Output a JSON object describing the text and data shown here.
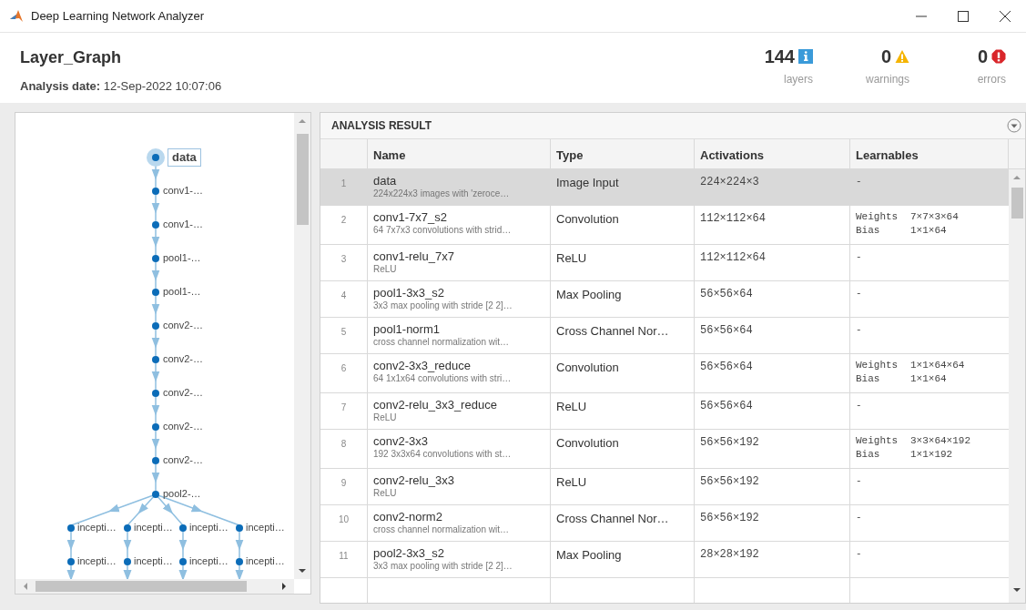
{
  "window": {
    "title": "Deep Learning Network Analyzer"
  },
  "header": {
    "network_name": "Layer_Graph",
    "date_label": "Analysis date:",
    "date_value": "12-Sep-2022 10:07:06"
  },
  "stats": [
    {
      "kind": "info",
      "count": "144",
      "label": "layers"
    },
    {
      "kind": "warning",
      "count": "0",
      "label": "warnings"
    },
    {
      "kind": "error",
      "count": "0",
      "label": "errors"
    }
  ],
  "graph": {
    "chain": [
      {
        "label": "data",
        "selected": true
      },
      {
        "label": "conv1-…",
        "selected": false
      },
      {
        "label": "conv1-…",
        "selected": false
      },
      {
        "label": "pool1-…",
        "selected": false
      },
      {
        "label": "pool1-…",
        "selected": false
      },
      {
        "label": "conv2-…",
        "selected": false
      },
      {
        "label": "conv2-…",
        "selected": false
      },
      {
        "label": "conv2-…",
        "selected": false
      },
      {
        "label": "conv2-…",
        "selected": false
      },
      {
        "label": "conv2-…",
        "selected": false
      },
      {
        "label": "pool2-…",
        "selected": false
      }
    ],
    "branches": [
      [
        {
          "label": "incepti…"
        },
        {
          "label": "incepti…"
        }
      ],
      [
        {
          "label": "incepti…"
        },
        {
          "label": "incepti…"
        }
      ],
      [
        {
          "label": "incepti…"
        },
        {
          "label": "incepti…"
        }
      ],
      [
        {
          "label": "incepti…"
        },
        {
          "label": "incepti…"
        }
      ]
    ]
  },
  "results": {
    "title": "ANALYSIS RESULT",
    "columns": [
      "Name",
      "Type",
      "Activations",
      "Learnables"
    ],
    "rows": [
      {
        "index": "1",
        "name": "data",
        "description": "224x224x3 images with 'zeroce…",
        "type": "Image Input",
        "activations": "224×224×3",
        "learnables": "-",
        "selected": true
      },
      {
        "index": "2",
        "name": "conv1-7x7_s2",
        "description": "64 7x7x3 convolutions with strid…",
        "type": "Convolution",
        "activations": "112×112×64",
        "learnables": [
          {
            "param": "Weights",
            "size": "7×7×3×64"
          },
          {
            "param": "Bias",
            "size": "1×1×64"
          }
        ],
        "selected": false
      },
      {
        "index": "3",
        "name": "conv1-relu_7x7",
        "description": "ReLU",
        "type": "ReLU",
        "activations": "112×112×64",
        "learnables": "-",
        "selected": false
      },
      {
        "index": "4",
        "name": "pool1-3x3_s2",
        "description": "3x3 max pooling with stride [2 2]…",
        "type": "Max Pooling",
        "activations": "56×56×64",
        "learnables": "-",
        "selected": false
      },
      {
        "index": "5",
        "name": "pool1-norm1",
        "description": "cross channel normalization wit…",
        "type": "Cross Channel Nor…",
        "activations": "56×56×64",
        "learnables": "-",
        "selected": false
      },
      {
        "index": "6",
        "name": "conv2-3x3_reduce",
        "description": "64 1x1x64 convolutions with stri…",
        "type": "Convolution",
        "activations": "56×56×64",
        "learnables": [
          {
            "param": "Weights",
            "size": "1×1×64×64"
          },
          {
            "param": "Bias",
            "size": "1×1×64"
          }
        ],
        "selected": false
      },
      {
        "index": "7",
        "name": "conv2-relu_3x3_reduce",
        "description": "ReLU",
        "type": "ReLU",
        "activations": "56×56×64",
        "learnables": "-",
        "selected": false
      },
      {
        "index": "8",
        "name": "conv2-3x3",
        "description": "192 3x3x64 convolutions with st…",
        "type": "Convolution",
        "activations": "56×56×192",
        "learnables": [
          {
            "param": "Weights",
            "size": "3×3×64×192"
          },
          {
            "param": "Bias",
            "size": "1×1×192"
          }
        ],
        "selected": false
      },
      {
        "index": "9",
        "name": "conv2-relu_3x3",
        "description": "ReLU",
        "type": "ReLU",
        "activations": "56×56×192",
        "learnables": "-",
        "selected": false
      },
      {
        "index": "10",
        "name": "conv2-norm2",
        "description": "cross channel normalization wit…",
        "type": "Cross Channel Nor…",
        "activations": "56×56×192",
        "learnables": "-",
        "selected": false
      },
      {
        "index": "11",
        "name": "pool2-3x3_s2",
        "description": "3x3 max pooling with stride [2 2]…",
        "type": "Max Pooling",
        "activations": "28×28×192",
        "learnables": "-",
        "selected": false
      }
    ]
  }
}
